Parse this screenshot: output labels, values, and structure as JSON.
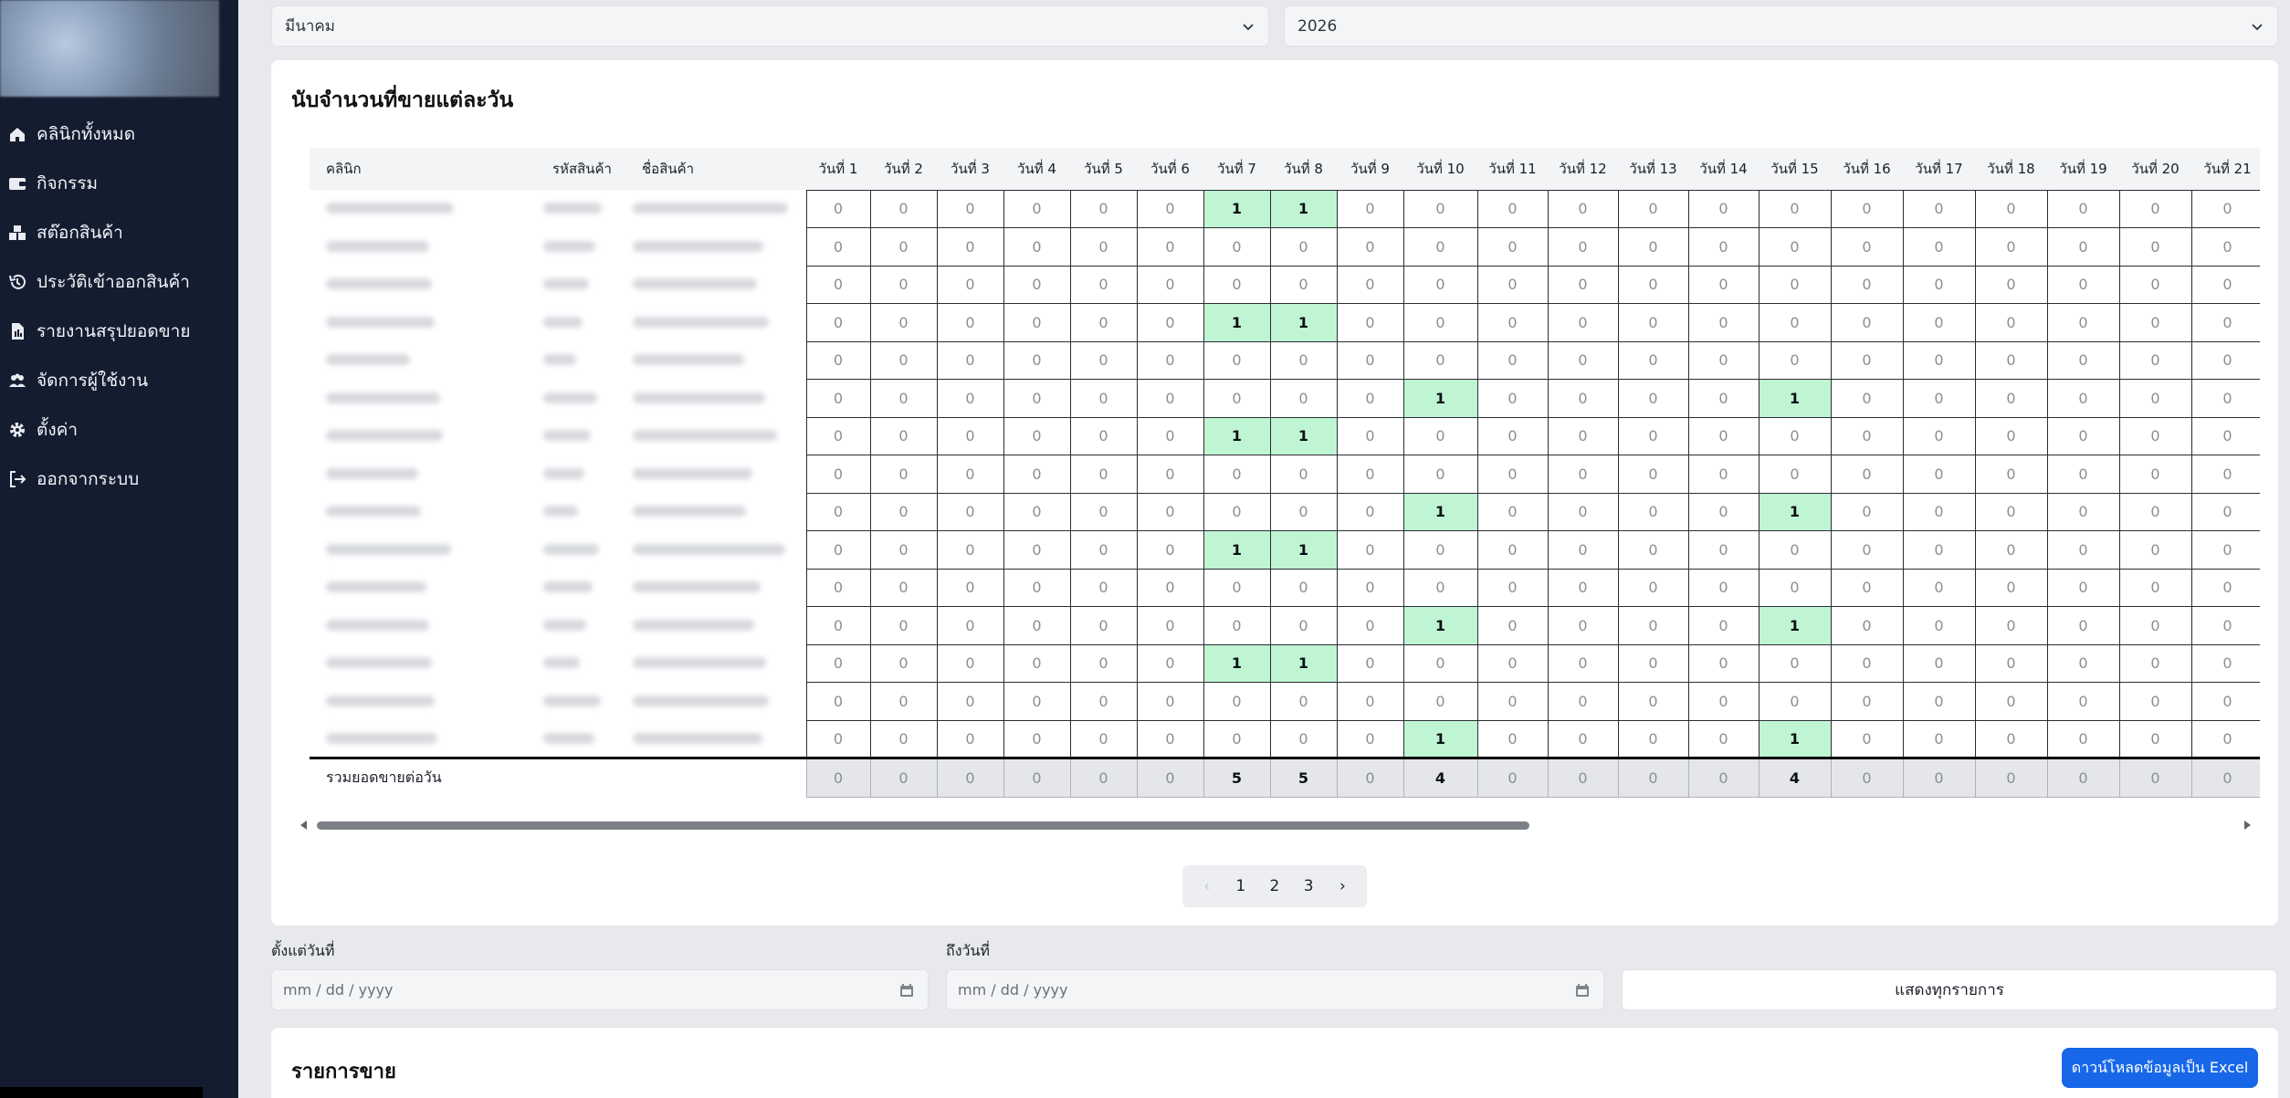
{
  "sidebar": {
    "items": [
      {
        "label": "คลินิกทั้งหมด",
        "icon": "home-icon"
      },
      {
        "label": "กิจกรรม",
        "icon": "wallet-icon"
      },
      {
        "label": "สต๊อกสินค้า",
        "icon": "boxes-icon"
      },
      {
        "label": "ประวัติเข้าออกสินค้า",
        "icon": "history-icon"
      },
      {
        "label": "รายงานสรุปยอดขาย",
        "icon": "report-icon"
      },
      {
        "label": "จัดการผู้ใช้งาน",
        "icon": "users-icon"
      },
      {
        "label": "ตั้งค่า",
        "icon": "gear-icon"
      },
      {
        "label": "ออกจากระบบ",
        "icon": "logout-icon"
      }
    ]
  },
  "filters": {
    "month": "มีนาคม",
    "year": "2026"
  },
  "daily": {
    "title": "นับจำนวนที่ขายแต่ละวัน",
    "columns": {
      "clinic": "คลินิก",
      "code": "รหัสสินค้า",
      "name": "ชื่อสินค้า"
    },
    "days": [
      "วันที่ 1",
      "วันที่ 2",
      "วันที่ 3",
      "วันที่ 4",
      "วันที่ 5",
      "วันที่ 6",
      "วันที่ 7",
      "วันที่ 8",
      "วันที่ 9",
      "วันที่ 10",
      "วันที่ 11",
      "วันที่ 12",
      "วันที่ 13",
      "วันที่ 14",
      "วันที่ 15",
      "วันที่ 16",
      "วันที่ 17",
      "วันที่ 18",
      "วันที่ 19",
      "วันที่ 20",
      "วันที่ 21"
    ],
    "rows": [
      [
        0,
        0,
        0,
        0,
        0,
        0,
        1,
        1,
        0,
        0,
        0,
        0,
        0,
        0,
        0,
        0,
        0,
        0,
        0,
        0,
        0
      ],
      [
        0,
        0,
        0,
        0,
        0,
        0,
        0,
        0,
        0,
        0,
        0,
        0,
        0,
        0,
        0,
        0,
        0,
        0,
        0,
        0,
        0
      ],
      [
        0,
        0,
        0,
        0,
        0,
        0,
        0,
        0,
        0,
        0,
        0,
        0,
        0,
        0,
        0,
        0,
        0,
        0,
        0,
        0,
        0
      ],
      [
        0,
        0,
        0,
        0,
        0,
        0,
        1,
        1,
        0,
        0,
        0,
        0,
        0,
        0,
        0,
        0,
        0,
        0,
        0,
        0,
        0
      ],
      [
        0,
        0,
        0,
        0,
        0,
        0,
        0,
        0,
        0,
        0,
        0,
        0,
        0,
        0,
        0,
        0,
        0,
        0,
        0,
        0,
        0
      ],
      [
        0,
        0,
        0,
        0,
        0,
        0,
        0,
        0,
        0,
        1,
        0,
        0,
        0,
        0,
        1,
        0,
        0,
        0,
        0,
        0,
        0
      ],
      [
        0,
        0,
        0,
        0,
        0,
        0,
        1,
        1,
        0,
        0,
        0,
        0,
        0,
        0,
        0,
        0,
        0,
        0,
        0,
        0,
        0
      ],
      [
        0,
        0,
        0,
        0,
        0,
        0,
        0,
        0,
        0,
        0,
        0,
        0,
        0,
        0,
        0,
        0,
        0,
        0,
        0,
        0,
        0
      ],
      [
        0,
        0,
        0,
        0,
        0,
        0,
        0,
        0,
        0,
        1,
        0,
        0,
        0,
        0,
        1,
        0,
        0,
        0,
        0,
        0,
        0
      ],
      [
        0,
        0,
        0,
        0,
        0,
        0,
        1,
        1,
        0,
        0,
        0,
        0,
        0,
        0,
        0,
        0,
        0,
        0,
        0,
        0,
        0
      ],
      [
        0,
        0,
        0,
        0,
        0,
        0,
        0,
        0,
        0,
        0,
        0,
        0,
        0,
        0,
        0,
        0,
        0,
        0,
        0,
        0,
        0
      ],
      [
        0,
        0,
        0,
        0,
        0,
        0,
        0,
        0,
        0,
        1,
        0,
        0,
        0,
        0,
        1,
        0,
        0,
        0,
        0,
        0,
        0
      ],
      [
        0,
        0,
        0,
        0,
        0,
        0,
        1,
        1,
        0,
        0,
        0,
        0,
        0,
        0,
        0,
        0,
        0,
        0,
        0,
        0,
        0
      ],
      [
        0,
        0,
        0,
        0,
        0,
        0,
        0,
        0,
        0,
        0,
        0,
        0,
        0,
        0,
        0,
        0,
        0,
        0,
        0,
        0,
        0
      ],
      [
        0,
        0,
        0,
        0,
        0,
        0,
        0,
        0,
        0,
        1,
        0,
        0,
        0,
        0,
        1,
        0,
        0,
        0,
        0,
        0,
        0
      ]
    ],
    "total_label": "รวมยอดขายต่อวัน",
    "totals": [
      0,
      0,
      0,
      0,
      0,
      0,
      5,
      5,
      0,
      4,
      0,
      0,
      0,
      0,
      4,
      0,
      0,
      0,
      0,
      0,
      0
    ],
    "highlight_color": "#bff5d3"
  },
  "pagination": {
    "prev": "‹",
    "pages": [
      "1",
      "2",
      "3"
    ],
    "next": "›"
  },
  "date_filter": {
    "from_label": "ตั้งแต่วันที่",
    "to_label": "ถึงวันที่",
    "from_placeholder": "mm / dd / yyyy",
    "to_placeholder": "mm / dd / yyyy",
    "show_all": "แสดงทุกรายการ"
  },
  "sales": {
    "title": "รายการขาย",
    "download": "ดาวน์โหลดข้อมูลเป็น Excel"
  },
  "colors": {
    "sidebar": "#141d30",
    "accent": "#1767e8"
  }
}
